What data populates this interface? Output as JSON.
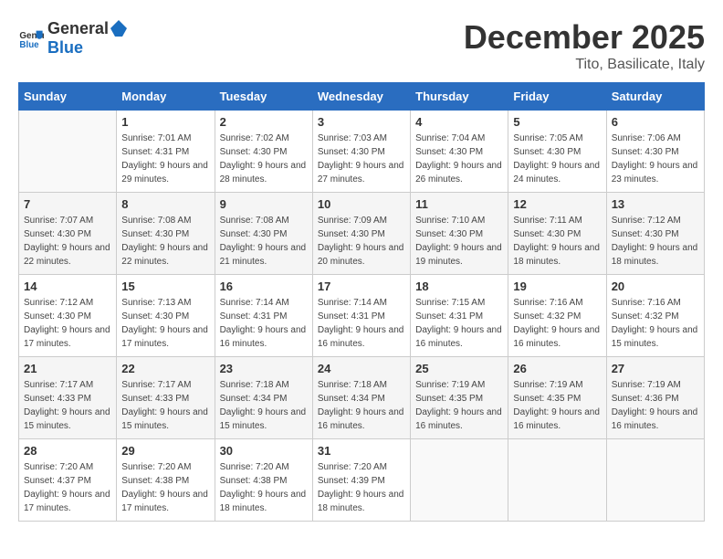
{
  "logo": {
    "general": "General",
    "blue": "Blue"
  },
  "header": {
    "month": "December 2025",
    "location": "Tito, Basilicate, Italy"
  },
  "weekdays": [
    "Sunday",
    "Monday",
    "Tuesday",
    "Wednesday",
    "Thursday",
    "Friday",
    "Saturday"
  ],
  "weeks": [
    [
      null,
      {
        "day": "1",
        "sunrise": "7:01 AM",
        "sunset": "4:31 PM",
        "daylight": "9 hours and 29 minutes."
      },
      {
        "day": "2",
        "sunrise": "7:02 AM",
        "sunset": "4:30 PM",
        "daylight": "9 hours and 28 minutes."
      },
      {
        "day": "3",
        "sunrise": "7:03 AM",
        "sunset": "4:30 PM",
        "daylight": "9 hours and 27 minutes."
      },
      {
        "day": "4",
        "sunrise": "7:04 AM",
        "sunset": "4:30 PM",
        "daylight": "9 hours and 26 minutes."
      },
      {
        "day": "5",
        "sunrise": "7:05 AM",
        "sunset": "4:30 PM",
        "daylight": "9 hours and 24 minutes."
      },
      {
        "day": "6",
        "sunrise": "7:06 AM",
        "sunset": "4:30 PM",
        "daylight": "9 hours and 23 minutes."
      }
    ],
    [
      {
        "day": "7",
        "sunrise": "7:07 AM",
        "sunset": "4:30 PM",
        "daylight": "9 hours and 22 minutes."
      },
      {
        "day": "8",
        "sunrise": "7:08 AM",
        "sunset": "4:30 PM",
        "daylight": "9 hours and 22 minutes."
      },
      {
        "day": "9",
        "sunrise": "7:08 AM",
        "sunset": "4:30 PM",
        "daylight": "9 hours and 21 minutes."
      },
      {
        "day": "10",
        "sunrise": "7:09 AM",
        "sunset": "4:30 PM",
        "daylight": "9 hours and 20 minutes."
      },
      {
        "day": "11",
        "sunrise": "7:10 AM",
        "sunset": "4:30 PM",
        "daylight": "9 hours and 19 minutes."
      },
      {
        "day": "12",
        "sunrise": "7:11 AM",
        "sunset": "4:30 PM",
        "daylight": "9 hours and 18 minutes."
      },
      {
        "day": "13",
        "sunrise": "7:12 AM",
        "sunset": "4:30 PM",
        "daylight": "9 hours and 18 minutes."
      }
    ],
    [
      {
        "day": "14",
        "sunrise": "7:12 AM",
        "sunset": "4:30 PM",
        "daylight": "9 hours and 17 minutes."
      },
      {
        "day": "15",
        "sunrise": "7:13 AM",
        "sunset": "4:30 PM",
        "daylight": "9 hours and 17 minutes."
      },
      {
        "day": "16",
        "sunrise": "7:14 AM",
        "sunset": "4:31 PM",
        "daylight": "9 hours and 16 minutes."
      },
      {
        "day": "17",
        "sunrise": "7:14 AM",
        "sunset": "4:31 PM",
        "daylight": "9 hours and 16 minutes."
      },
      {
        "day": "18",
        "sunrise": "7:15 AM",
        "sunset": "4:31 PM",
        "daylight": "9 hours and 16 minutes."
      },
      {
        "day": "19",
        "sunrise": "7:16 AM",
        "sunset": "4:32 PM",
        "daylight": "9 hours and 16 minutes."
      },
      {
        "day": "20",
        "sunrise": "7:16 AM",
        "sunset": "4:32 PM",
        "daylight": "9 hours and 15 minutes."
      }
    ],
    [
      {
        "day": "21",
        "sunrise": "7:17 AM",
        "sunset": "4:33 PM",
        "daylight": "9 hours and 15 minutes."
      },
      {
        "day": "22",
        "sunrise": "7:17 AM",
        "sunset": "4:33 PM",
        "daylight": "9 hours and 15 minutes."
      },
      {
        "day": "23",
        "sunrise": "7:18 AM",
        "sunset": "4:34 PM",
        "daylight": "9 hours and 15 minutes."
      },
      {
        "day": "24",
        "sunrise": "7:18 AM",
        "sunset": "4:34 PM",
        "daylight": "9 hours and 16 minutes."
      },
      {
        "day": "25",
        "sunrise": "7:19 AM",
        "sunset": "4:35 PM",
        "daylight": "9 hours and 16 minutes."
      },
      {
        "day": "26",
        "sunrise": "7:19 AM",
        "sunset": "4:35 PM",
        "daylight": "9 hours and 16 minutes."
      },
      {
        "day": "27",
        "sunrise": "7:19 AM",
        "sunset": "4:36 PM",
        "daylight": "9 hours and 16 minutes."
      }
    ],
    [
      {
        "day": "28",
        "sunrise": "7:20 AM",
        "sunset": "4:37 PM",
        "daylight": "9 hours and 17 minutes."
      },
      {
        "day": "29",
        "sunrise": "7:20 AM",
        "sunset": "4:38 PM",
        "daylight": "9 hours and 17 minutes."
      },
      {
        "day": "30",
        "sunrise": "7:20 AM",
        "sunset": "4:38 PM",
        "daylight": "9 hours and 18 minutes."
      },
      {
        "day": "31",
        "sunrise": "7:20 AM",
        "sunset": "4:39 PM",
        "daylight": "9 hours and 18 minutes."
      },
      null,
      null,
      null
    ]
  ]
}
